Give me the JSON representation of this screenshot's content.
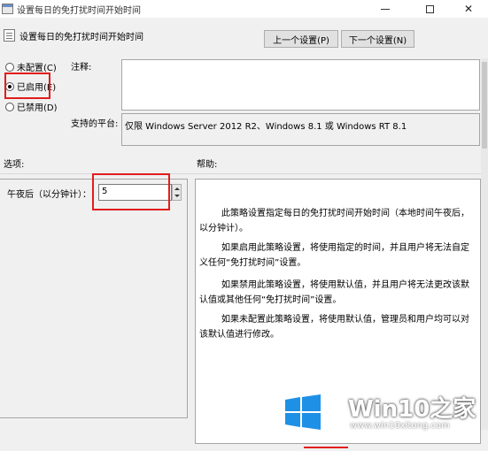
{
  "window": {
    "title": "设置每日的免打扰时间开始时间",
    "controls": {
      "minimize": "minimize",
      "maximize": "maximize",
      "close": "✕"
    }
  },
  "header": {
    "policy_title": "设置每日的免打扰时间开始时间",
    "prev_button": "上一个设置(P)",
    "next_button": "下一个设置(N)"
  },
  "state": {
    "options": [
      {
        "label": "未配置(C)",
        "selected": false
      },
      {
        "label": "已启用(E)",
        "selected": true
      },
      {
        "label": "已禁用(D)",
        "selected": false
      }
    ]
  },
  "comment": {
    "label": "注释:",
    "value": ""
  },
  "platform": {
    "label": "支持的平台:",
    "value": "仅限 Windows Server 2012 R2、Windows 8.1 或 Windows RT 8.1"
  },
  "sections": {
    "options_label": "选项:",
    "help_label": "帮助:"
  },
  "options_panel": {
    "minutes_label": "午夜后（以分钟计）：",
    "minutes_value": "5"
  },
  "help": {
    "paragraphs": [
      "此策略设置指定每日的免打扰时间开始时间（本地时间午夜后，以分钟计）。",
      "如果启用此策略设置，将使用指定的时间，并且用户将无法自定义任何“免打扰时间”设置。",
      "如果禁用此策略设置，将使用默认值，并且用户将无法更改该默认值或其他任何“免打扰时间”设置。",
      "如果未配置此策略设置，将使用默认值，管理员和用户均可以对该默认值进行修改。"
    ]
  },
  "watermark": {
    "brand": "Win10之家",
    "url": "www.win10xitong.com",
    "colors": {
      "logo_blue": "#1e90e6"
    }
  },
  "colors": {
    "highlight_red": "#e21d1d",
    "window_bg": "#f0f0f0"
  }
}
